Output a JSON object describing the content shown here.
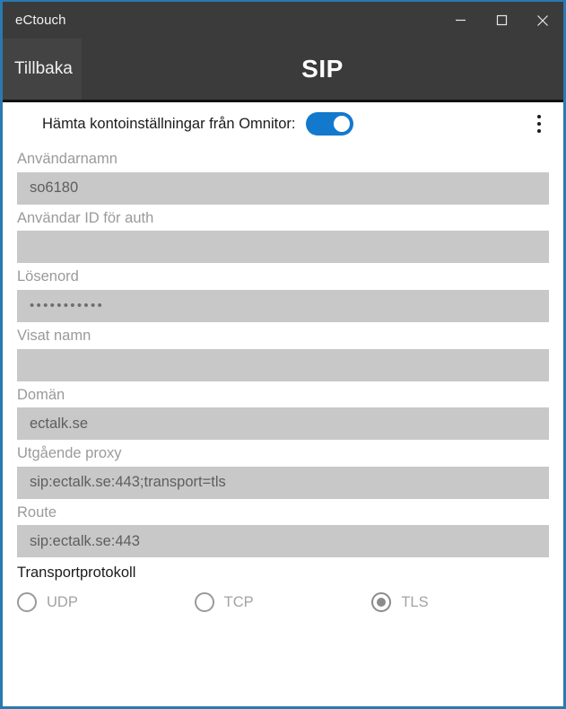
{
  "window": {
    "title": "eCtouch",
    "border_color": "#2a7ab0",
    "controls": [
      {
        "name": "minimize",
        "glyph": "minimize-icon"
      },
      {
        "name": "maximize",
        "glyph": "maximize-icon"
      },
      {
        "name": "close",
        "glyph": "close-icon"
      }
    ]
  },
  "appbar": {
    "back_label": "Tillbaka",
    "title": "SIP"
  },
  "toggle": {
    "label": "Hämta kontoinställningar från Omnitor:",
    "state": "on",
    "accent_color": "#1379cd"
  },
  "overflow_menu": {
    "icon": "kebab-menu-icon"
  },
  "fields": [
    {
      "label": "Användarnamn",
      "value": "so6180",
      "type": "text"
    },
    {
      "label": "Användar ID för auth",
      "value": "",
      "type": "text"
    },
    {
      "label": "Lösenord",
      "value": "•••••••••••",
      "type": "password"
    },
    {
      "label": "Visat namn",
      "value": "",
      "type": "text"
    },
    {
      "label": "Domän",
      "value": "ectalk.se",
      "type": "text"
    },
    {
      "label": "Utgående proxy",
      "value": "sip:ectalk.se:443;transport=tls",
      "type": "text"
    },
    {
      "label": "Route",
      "value": "sip:ectalk.se:443",
      "type": "text"
    }
  ],
  "transport": {
    "section_title": "Transportprotokoll",
    "options": [
      {
        "label": "UDP",
        "selected": false
      },
      {
        "label": "TCP",
        "selected": false
      },
      {
        "label": "TLS",
        "selected": true
      }
    ]
  }
}
